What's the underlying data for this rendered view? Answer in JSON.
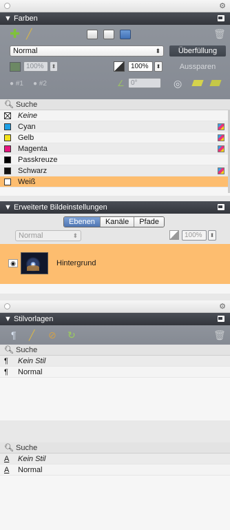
{
  "farben": {
    "title": "▼ Farben",
    "mode_select": "Normal",
    "ueberfuellung_label": "Überfüllung",
    "aussparen_label": "Aussparen",
    "fill_pct": "100%",
    "stroke_pct": "100%",
    "angle": "0°",
    "radio1": "#1",
    "radio2": "#2",
    "search_label": "Suche",
    "colors": [
      {
        "name": "Keine",
        "swatch": "none",
        "italic": true,
        "sep": false
      },
      {
        "name": "Cyan",
        "swatch": "#1ea0e6",
        "italic": false,
        "sep": true
      },
      {
        "name": "Gelb",
        "swatch": "#f3e21c",
        "italic": false,
        "sep": true
      },
      {
        "name": "Magenta",
        "swatch": "#e6157f",
        "italic": false,
        "sep": true
      },
      {
        "name": "Passkreuze",
        "swatch": "#000000",
        "italic": false,
        "sep": false
      },
      {
        "name": "Schwarz",
        "swatch": "#111111",
        "italic": false,
        "sep": true
      },
      {
        "name": "Weiß",
        "swatch": "#ffffff",
        "italic": false,
        "sep": false,
        "selected": true
      }
    ]
  },
  "bildeinstellungen": {
    "title": "▼ Erweiterte Bildeinstellungen",
    "tabs": [
      "Ebenen",
      "Kanäle",
      "Pfade"
    ],
    "active_tab": "Ebenen",
    "mode_select": "Normal",
    "opacity": "100%",
    "layer_name": "Hintergrund"
  },
  "stilvorlagen": {
    "title": "▼ Stilvorlagen",
    "search_label": "Suche",
    "paragraph_styles": [
      {
        "name": "Kein Stil",
        "italic": true
      },
      {
        "name": "Normal",
        "italic": false
      }
    ],
    "char_search_label": "Suche",
    "char_styles": [
      {
        "name": "Kein Stil",
        "italic": true
      },
      {
        "name": "Normal",
        "italic": false
      }
    ]
  },
  "colors": {
    "selection": "#fdbd6f",
    "panel_gray": "#8a8f97",
    "header_dark": "#3a3d44"
  }
}
